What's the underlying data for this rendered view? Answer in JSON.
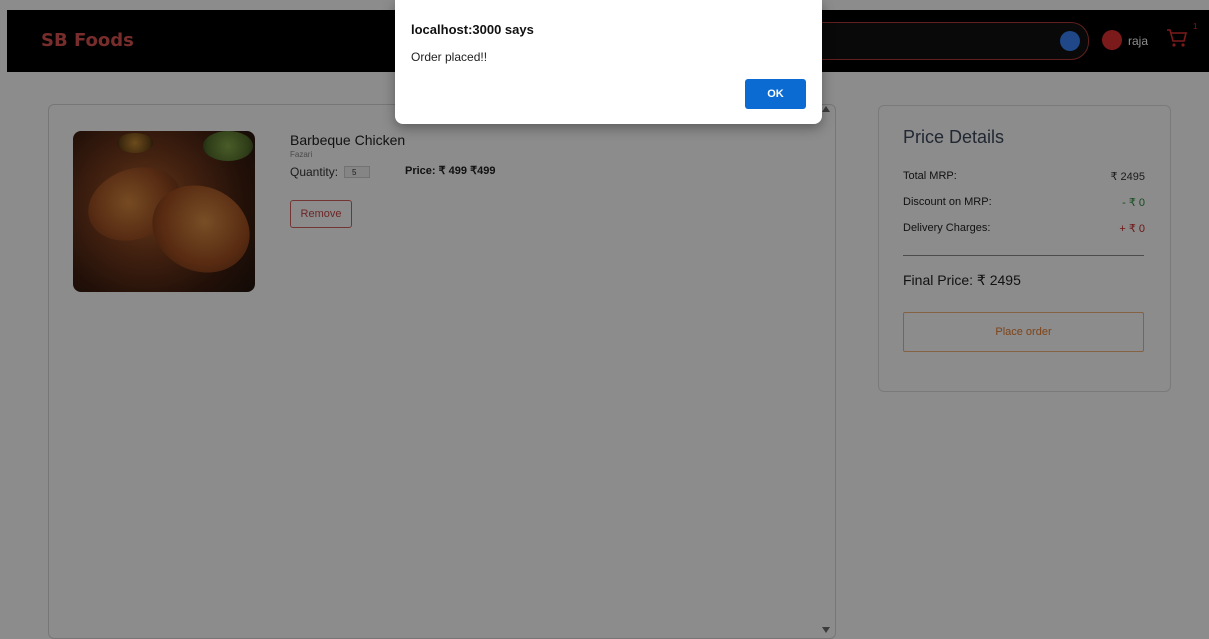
{
  "header": {
    "brand": "SB Foods",
    "username": "raja",
    "cart_count": "1",
    "colors": {
      "brand": "#d9534f",
      "navbar": "#000000"
    }
  },
  "cart": {
    "items": [
      {
        "name": "Barbeque Chicken",
        "restaurant": "Fazari",
        "quantity_label": "Quantity:",
        "quantity": "5",
        "price_text": "Price: ₹ 499 ₹499",
        "remove_label": "Remove"
      }
    ]
  },
  "price_details": {
    "title": "Price Details",
    "rows": [
      {
        "label": "Total MRP:",
        "value": "₹ 2495",
        "color": "#333333"
      },
      {
        "label": "Discount on MRP:",
        "value": "- ₹ 0",
        "color": "#2b8a3e"
      },
      {
        "label": "Delivery Charges:",
        "value": "+ ₹ 0",
        "color": "#c92a2a"
      }
    ],
    "final_label": "Final Price: ₹ 2495",
    "place_order_label": "Place order"
  },
  "alert": {
    "title": "localhost:3000 says",
    "message": "Order placed!!",
    "ok_label": "OK"
  }
}
